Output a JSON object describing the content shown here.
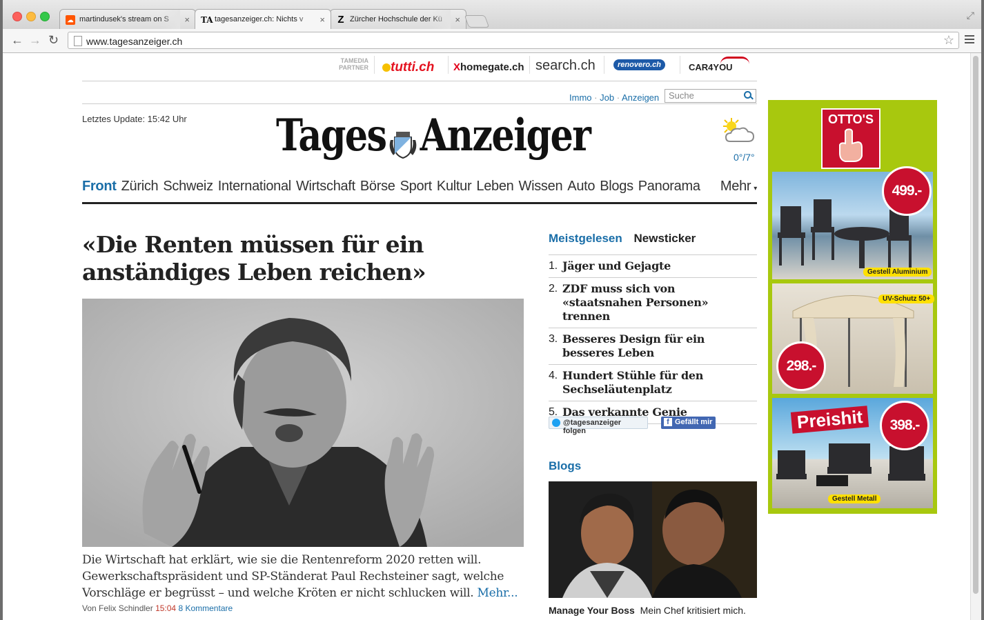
{
  "browser": {
    "tabs": [
      {
        "title": "martindusek's stream on S",
        "favicon": "soundcloud-icon",
        "active": false
      },
      {
        "title": "tagesanzeiger.ch: Nichts v",
        "favicon": "tagesanzeiger-icon",
        "active": true
      },
      {
        "title": "Zürcher Hochschule der Kü",
        "favicon": "zhdk-icon",
        "active": false
      }
    ],
    "url": "www.tagesanzeiger.ch"
  },
  "partners": {
    "label": "TAMEDIA PARTNER",
    "logos": [
      "tutti.ch",
      "homegate.ch",
      "search.ch",
      "renovero.ch",
      "CAR4YOU"
    ]
  },
  "toplinks": [
    "Immo",
    "Job",
    "Anzeigen"
  ],
  "toplinks_sep": "·",
  "search": {
    "placeholder": "Suche"
  },
  "update": "Letztes Update: 15:42 Uhr",
  "masthead": {
    "left": "Tages",
    "right": "Anzeiger"
  },
  "weather": {
    "temp": "0°/7°",
    "icon": "sun-cloud-icon"
  },
  "nav": {
    "items": [
      "Front",
      "Zürich",
      "Schweiz",
      "International",
      "Wirtschaft",
      "Börse",
      "Sport",
      "Kultur",
      "Leben",
      "Wissen",
      "Auto",
      "Blogs",
      "Panorama"
    ],
    "more": "Mehr"
  },
  "article": {
    "headline": "«Die Renten müssen für ein anständiges Leben reichen»",
    "lead": "Die Wirtschaft hat erklärt, wie sie die Rentenreform 2020 retten will. Gewerkschaftspräsident und SP-Ständerat Paul Rechsteiner sagt, welche Vorschläge er begrüsst – und welche Kröten er nicht schlucken will.",
    "more": "Mehr...",
    "byline": "Von Felix Schindler",
    "time": "15:04",
    "comments": "8 Kommentare"
  },
  "sidebar": {
    "tab_active": "Meistgelesen",
    "tab_other": "Newsticker",
    "items": [
      {
        "n": "1.",
        "text": "Jäger und Gejagte"
      },
      {
        "n": "2.",
        "text": "ZDF muss sich von «staatsnahen Personen» trennen"
      },
      {
        "n": "3.",
        "text": "Besseres Design für ein besseres Leben"
      },
      {
        "n": "4.",
        "text": "Hundert Stühle für den Sechseläutenplatz"
      },
      {
        "n": "5.",
        "text": "Das verkannte Genie"
      }
    ],
    "twitter": "@tagesanzeiger folgen",
    "facebook": "Gefällt mir",
    "blogs_title": "Blogs",
    "blog_name": "Manage Your Boss",
    "blog_teaser": "Mein Chef kritisiert mich."
  },
  "ad": {
    "brand": "OTTO'S",
    "prices": [
      "499.-",
      "298.-",
      "398.-"
    ],
    "tags": [
      "Gestell Aluminium",
      "UV-Schutz 50+",
      "Gestell Metall"
    ],
    "headline": "Preishit"
  }
}
